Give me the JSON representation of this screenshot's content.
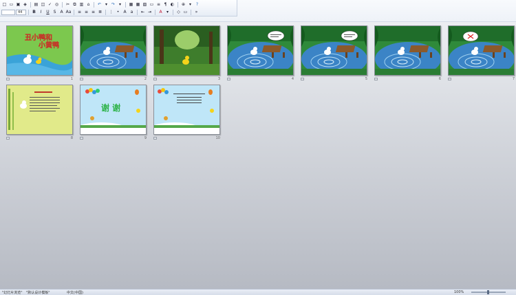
{
  "toolbar": {
    "font_name": "",
    "font_size": "44",
    "bold_label": "B",
    "italic_label": "I",
    "underline_label": "U",
    "strike_label": "S",
    "shadow_label": "S",
    "font_grow_label": "A",
    "font_shrink_label": "Aa",
    "font_color_label": "A"
  },
  "slides": [
    {
      "index": 1,
      "number": "1",
      "theme": "title-green"
    },
    {
      "index": 2,
      "number": "2",
      "theme": "pond"
    },
    {
      "index": 3,
      "number": "3",
      "theme": "forest"
    },
    {
      "index": 4,
      "number": "4",
      "theme": "pond-bubble"
    },
    {
      "index": 5,
      "number": "5",
      "theme": "pond-bubble"
    },
    {
      "index": 6,
      "number": "6",
      "theme": "pond"
    },
    {
      "index": 7,
      "number": "7",
      "theme": "pond-red"
    },
    {
      "index": 8,
      "number": "8",
      "theme": "text-yellow"
    },
    {
      "index": 9,
      "number": "9",
      "theme": "thanks"
    },
    {
      "index": 10,
      "number": "10",
      "theme": "sky-text"
    }
  ],
  "slide_text": {
    "title_line1": "丑小鸭和",
    "title_line2": "小黄鸭",
    "thanks": "谢 谢"
  },
  "statusbar": {
    "slide_info": "\"幻灯片浏览\"",
    "theme": "\"默认设计模板\"",
    "language": "中文(中国)",
    "zoom": "100%"
  },
  "colors": {
    "accent": "#2a6ebb",
    "sorter_bg_top": "#eceef2",
    "sorter_bg_bottom": "#b6bac3"
  }
}
